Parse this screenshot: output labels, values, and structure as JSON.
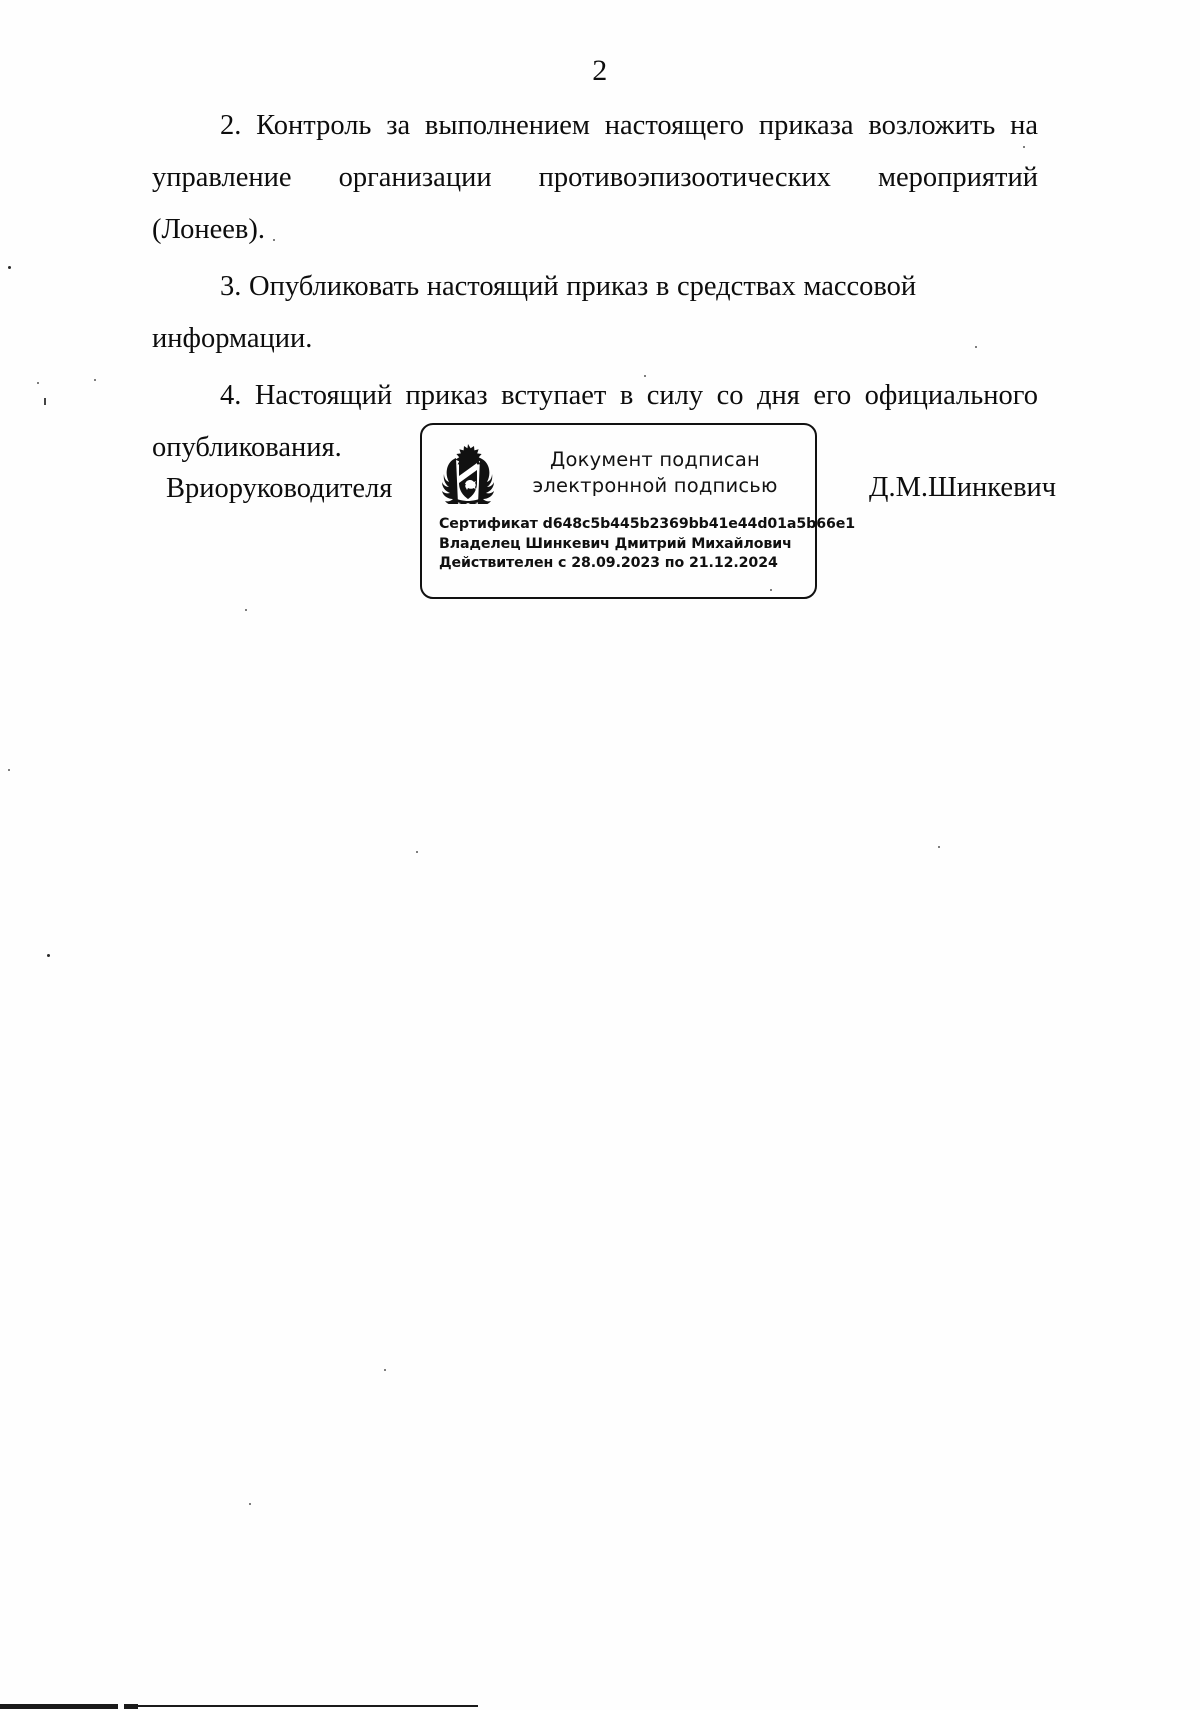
{
  "document": {
    "page_number": "2",
    "paragraphs": [
      "2. Контроль за выполнением настоящего приказа возложить на управление организации противоэпизоотических  мероприятий (Лонеев).",
      "3. Опубликовать настоящий приказ в средствах массовой информации.",
      "4. Настоящий приказ вступает в силу со дня его официального опубликования."
    ],
    "signature": {
      "title": "Вриоруководителя",
      "name": "Д.М.Шинкевич"
    },
    "e_signature_stamp": {
      "title_line1": "Документ подписан",
      "title_line2": "электронной подписью",
      "certificate": "Сертификат d648c5b445b2369bb41e44d01a5b66e1",
      "owner": "Владелец Шинкевич Дмитрий Михайлович",
      "validity": "Действителен с 28.09.2023 по 21.12.2024",
      "emblem_name": "coat-of-arms-emblem"
    }
  }
}
